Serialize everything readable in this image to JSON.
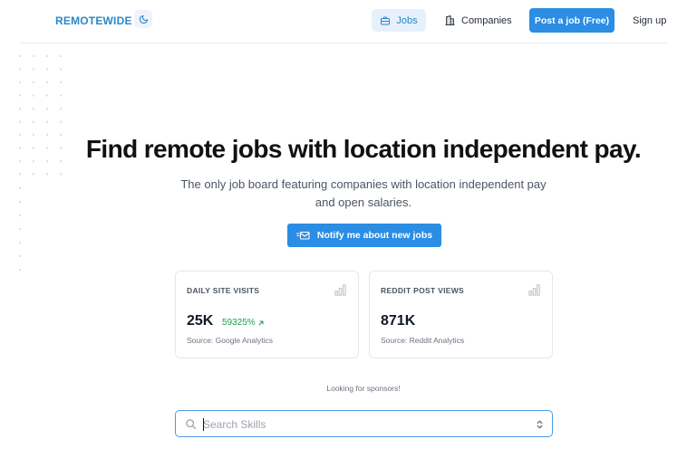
{
  "header": {
    "logo": "REMOTEWIDE",
    "nav": {
      "jobs": "Jobs",
      "companies": "Companies",
      "post_job": "Post a job (Free)",
      "sign_up": "Sign up"
    }
  },
  "hero": {
    "title": "Find remote jobs with location independent pay.",
    "subtitle_line1": "The only job board featuring companies with location independent pay",
    "subtitle_line2": "and open salaries.",
    "notify_button": "Notify me about new jobs"
  },
  "stats": [
    {
      "label": "DAILY SITE VISITS",
      "value": "25K",
      "change": "59325%",
      "source": "Source: Google Analytics"
    },
    {
      "label": "REDDIT POST VIEWS",
      "value": "871K",
      "source": "Source: Reddit Analytics"
    }
  ],
  "sponsors_text": "Looking for sponsors!",
  "search": {
    "placeholder": "Search Skills"
  },
  "colors": {
    "brand": "#2c87c9",
    "primary_button": "#2b8de3",
    "positive": "#16a34a",
    "active_nav_bg": "#e6f1fc"
  },
  "icons": {
    "theme": "moon-icon",
    "jobs": "briefcase-icon",
    "companies": "building-icon",
    "notify": "mail-fast-icon",
    "stat": "bar-chart-icon",
    "change": "arrow-up-right-icon",
    "search": "search-icon",
    "select": "chevron-up-down-icon"
  }
}
